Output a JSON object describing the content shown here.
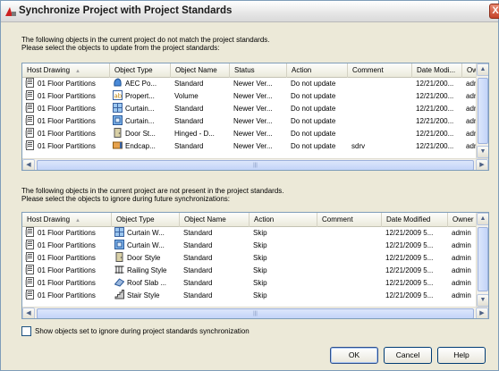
{
  "window": {
    "title": "Synchronize Project with Project Standards",
    "close_label": "X"
  },
  "top_section": {
    "intro_line1": "The following objects in the current project do not match the project standards.",
    "intro_line2": "Please select the objects to update from the project standards:",
    "columns": [
      "Host Drawing",
      "Object Type",
      "Object Name",
      "Status",
      "Action",
      "Comment",
      "Date Modi...",
      "Owner"
    ],
    "sorted_column": "Host Drawing",
    "rows": [
      {
        "host": "01 Floor Partitions",
        "type_icon": "aec-profile-icon",
        "type": "AEC Po...",
        "name": "Standard",
        "status": "Newer Ver...",
        "action": "Do not update",
        "comment": "",
        "date": "12/21/200...",
        "owner": "admin"
      },
      {
        "host": "01 Floor Partitions",
        "type_icon": "property-set-icon",
        "type": "Propert...",
        "name": "Volume",
        "status": "Newer Ver...",
        "action": "Do not update",
        "comment": "",
        "date": "12/21/200...",
        "owner": "admin"
      },
      {
        "host": "01 Floor Partitions",
        "type_icon": "curtain-wall-icon",
        "type": "Curtain...",
        "name": "Standard",
        "status": "Newer Ver...",
        "action": "Do not update",
        "comment": "",
        "date": "12/21/200...",
        "owner": "admin"
      },
      {
        "host": "01 Floor Partitions",
        "type_icon": "curtain-wall-unit-icon",
        "type": "Curtain...",
        "name": "Standard",
        "status": "Newer Ver...",
        "action": "Do not update",
        "comment": "",
        "date": "12/21/200...",
        "owner": "admin"
      },
      {
        "host": "01 Floor Partitions",
        "type_icon": "door-style-icon",
        "type": "Door St...",
        "name": "Hinged - D...",
        "status": "Newer Ver...",
        "action": "Do not update",
        "comment": "",
        "date": "12/21/200...",
        "owner": "admin"
      },
      {
        "host": "01 Floor Partitions",
        "type_icon": "endcap-icon",
        "type": "Endcap...",
        "name": "Standard",
        "status": "Newer Ver...",
        "action": "Do not update",
        "comment": "sdrv",
        "date": "12/21/200...",
        "owner": "admin"
      }
    ]
  },
  "bottom_section": {
    "intro_line1": "The following objects in the current project are not present in the project standards.",
    "intro_line2": "Please select the objects to ignore during future synchronizations:",
    "columns": [
      "Host Drawing",
      "Object Type",
      "Object Name",
      "Action",
      "Comment",
      "Date Modified",
      "Owner"
    ],
    "sorted_column": "Host Drawing",
    "rows": [
      {
        "host": "01 Floor Partitions",
        "type_icon": "curtain-wall-icon",
        "type": "Curtain W...",
        "name": "Standard",
        "action": "Skip",
        "comment": "",
        "date": "12/21/2009 5...",
        "owner": "admin"
      },
      {
        "host": "01 Floor Partitions",
        "type_icon": "curtain-wall-unit-icon",
        "type": "Curtain W...",
        "name": "Standard",
        "action": "Skip",
        "comment": "",
        "date": "12/21/2009 5...",
        "owner": "admin"
      },
      {
        "host": "01 Floor Partitions",
        "type_icon": "door-style-icon",
        "type": "Door Style",
        "name": "Standard",
        "action": "Skip",
        "comment": "",
        "date": "12/21/2009 5...",
        "owner": "admin"
      },
      {
        "host": "01 Floor Partitions",
        "type_icon": "railing-style-icon",
        "type": "Railing Style",
        "name": "Standard",
        "action": "Skip",
        "comment": "",
        "date": "12/21/2009 5...",
        "owner": "admin"
      },
      {
        "host": "01 Floor Partitions",
        "type_icon": "roof-slab-icon",
        "type": "Roof Slab ...",
        "name": "Standard",
        "action": "Skip",
        "comment": "",
        "date": "12/21/2009 5...",
        "owner": "admin"
      },
      {
        "host": "01 Floor Partitions",
        "type_icon": "stair-style-icon",
        "type": "Stair Style",
        "name": "Standard",
        "action": "Skip",
        "comment": "",
        "date": "12/21/2009 5...",
        "owner": "admin"
      }
    ]
  },
  "show_ignored_checkbox": {
    "label": "Show objects set to ignore during project standards synchronization",
    "checked": false
  },
  "buttons": {
    "ok": "OK",
    "cancel": "Cancel",
    "help": "Help"
  },
  "colors": {
    "title_icon_red": "#cc2020",
    "header_bg": "#ebeadb",
    "grid_border": "#7f9db9",
    "dialog_bg": "#ece9d8"
  }
}
